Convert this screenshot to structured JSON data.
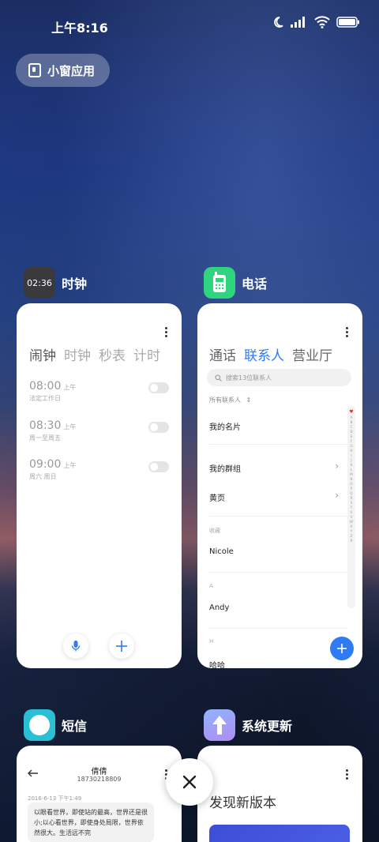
{
  "status_bar": {
    "time": "上午8:16"
  },
  "small_window_button": {
    "label": "小窗应用"
  },
  "apps": {
    "clock": {
      "name": "时钟",
      "icon_text": "02:36",
      "tabs": [
        "闹钟",
        "时钟",
        "秒表",
        "计时"
      ],
      "alarms": [
        {
          "time": "08:00",
          "ampm": "上午",
          "repeat": "法定工作日"
        },
        {
          "time": "08:30",
          "ampm": "上午",
          "repeat": "周一至周五"
        },
        {
          "time": "09:00",
          "ampm": "上午",
          "repeat": "周六 周日"
        }
      ]
    },
    "phone": {
      "name": "电话",
      "tabs": [
        "通话",
        "联系人",
        "营业厅"
      ],
      "search_placeholder": "搜索13位联系人",
      "filter_label": "所有联系人",
      "my_card": "我的名片",
      "my_groups": "我的群组",
      "yellow_pages": "黄页",
      "favorites_label": "收藏",
      "favorite_contact": "Nicole",
      "section_a": "A",
      "contact_a": "Andy",
      "section_h": "H",
      "contact_h": "哈哈",
      "alpha_index": [
        "♥",
        "A",
        "B",
        "C",
        "D",
        "E",
        "F",
        "G",
        "H",
        "I",
        "J",
        "K",
        "L",
        "M",
        "N",
        "O",
        "P",
        "Q",
        "R",
        "S",
        "T",
        "U",
        "V",
        "W",
        "X",
        "Y",
        "Z",
        "#"
      ]
    },
    "sms": {
      "name": "短信",
      "contact_name": "倩倩",
      "contact_number": "18730218809",
      "date": "2016-6-13 下午1:49",
      "message": "以眼看世界，即使站的最高，世界还是很小;以心看世界，即使身处局限，世界依然很大。生活远不完"
    },
    "update": {
      "name": "系统更新",
      "title": "发现新版本"
    }
  },
  "colors": {
    "accent_blue": "#2f7bf3",
    "phone_icon": "#2ed47e",
    "sms_icon": "#2bbfd6"
  }
}
